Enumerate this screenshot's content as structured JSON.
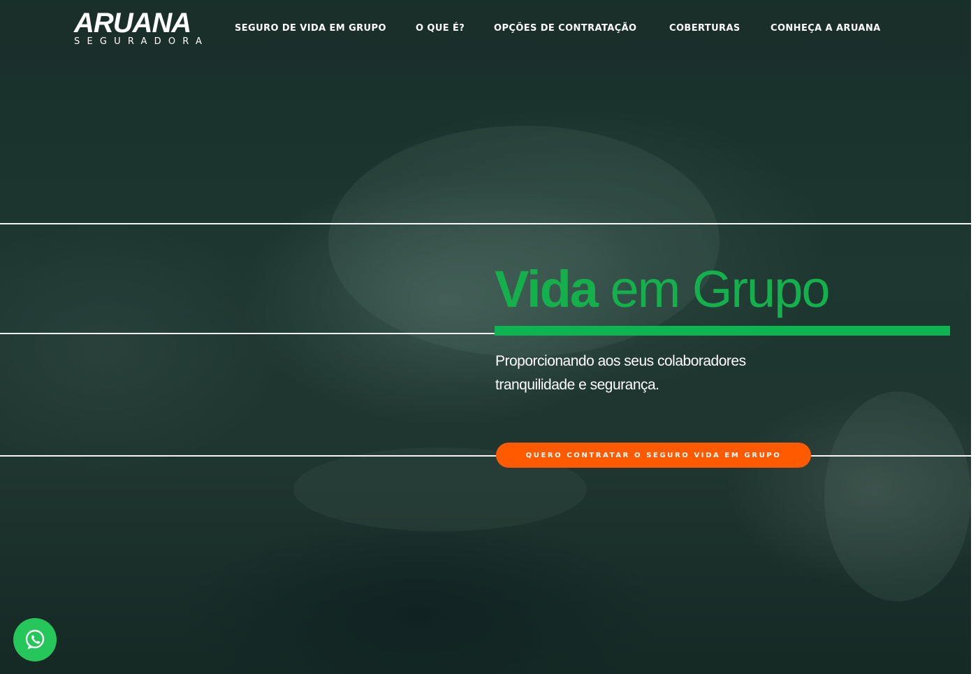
{
  "brand": {
    "name": "ARUANA",
    "subtitle": "SEGURADORA"
  },
  "nav": {
    "items": [
      {
        "label": "SEGURO DE VIDA EM GRUPO"
      },
      {
        "label": "O QUE É?"
      },
      {
        "label": "OPÇÕES DE CONTRATAÇÃO"
      },
      {
        "label": "COBERTURAS"
      },
      {
        "label": "CONHEÇA A ARUANA"
      }
    ]
  },
  "hero": {
    "title_bold": "Vida",
    "title_light": " em Grupo",
    "subtitle_line1": "Proporcionando aos seus colaboradores",
    "subtitle_line2": "tranquilidade e segurança.",
    "cta_label": "QUERO CONTRATAR O SEGURO VIDA EM GRUPO"
  },
  "floating": {
    "whatsapp_icon": "whatsapp-icon"
  },
  "colors": {
    "accent_green": "#13b04c",
    "cta_orange": "#ff5a00",
    "whatsapp_green": "#26c75a"
  }
}
